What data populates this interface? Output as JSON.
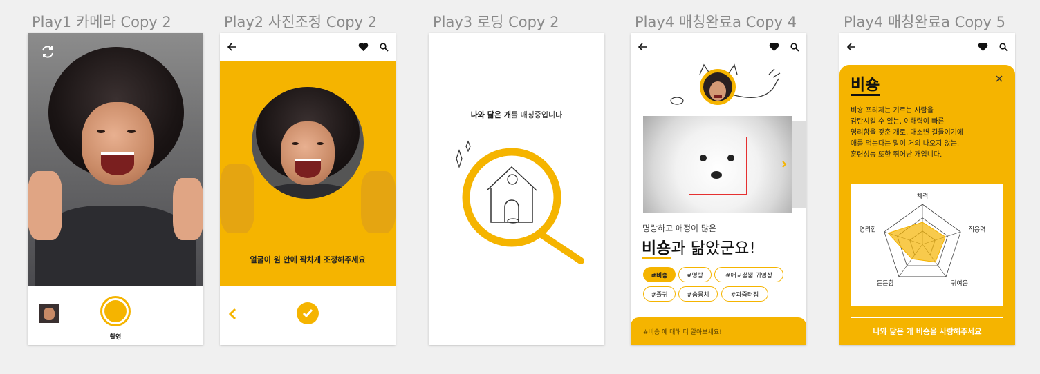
{
  "frames": [
    {
      "title": "Play1 카메라 Copy 2"
    },
    {
      "title": "Play2 사진조정 Copy 2"
    },
    {
      "title": "Play3 로딩 Copy 2"
    },
    {
      "title": "Play4 매칭완료a Copy 4"
    },
    {
      "title": "Play4 매칭완료a Copy 5"
    }
  ],
  "colors": {
    "accent": "#f5b400",
    "text": "#222222",
    "bg": "#f0f0f0"
  },
  "camera": {
    "shoot_label": "촬영"
  },
  "adjust": {
    "instruction": "얼굴이 원 안에 꽉차게 조정해주세요"
  },
  "loading": {
    "text_bold": "나와 닮은 개",
    "text_rest": "를 매칭중입니다"
  },
  "match": {
    "subtitle": "명랑하고 애정이 많은",
    "breed": "비숑",
    "result_suffix": "과 닮았군요!",
    "tags": [
      "#비숑",
      "#명랑",
      "#애교뿜뿜 귀염상",
      "#졸귀",
      "#솜뭉치",
      "#과즙터짐"
    ],
    "more_button": "#비숑 에 대해 더 알아보세요!"
  },
  "detail": {
    "breed": "비숑",
    "description": "비숑 프리제는 기르는 사람을 감탄시킬 수 있는, 이해력이 빠른 영리함을 갖춘 개로, 대소변 길들이기에 애를 먹는다는 말이 거의 나오지 않는, 훈련성능 또한 뛰어난 개입니다.",
    "desc_lines": [
      "비숑 프리제는 기르는 사람을",
      "감탄시킬 수 있는, 이해력이 빠른",
      "영리함을 갖춘 개로, 대소변 길들이기에",
      "애를 먹는다는 말이 거의 나오지 않는,",
      "훈련성능 또한 뛰어난 개입니다."
    ],
    "radar_labels": [
      "체격",
      "적응력",
      "귀여움",
      "든든함",
      "영리함"
    ],
    "radar_values": [
      0.55,
      0.6,
      0.55,
      0.45,
      0.9
    ],
    "cta": "나와 닮은 개 비숑을 사랑해주세요"
  },
  "icons": [
    "back-arrow-icon",
    "heart-icon",
    "search-icon",
    "camera-switch-icon",
    "chevron-left-icon",
    "check-icon",
    "chevron-right-icon",
    "close-icon"
  ]
}
